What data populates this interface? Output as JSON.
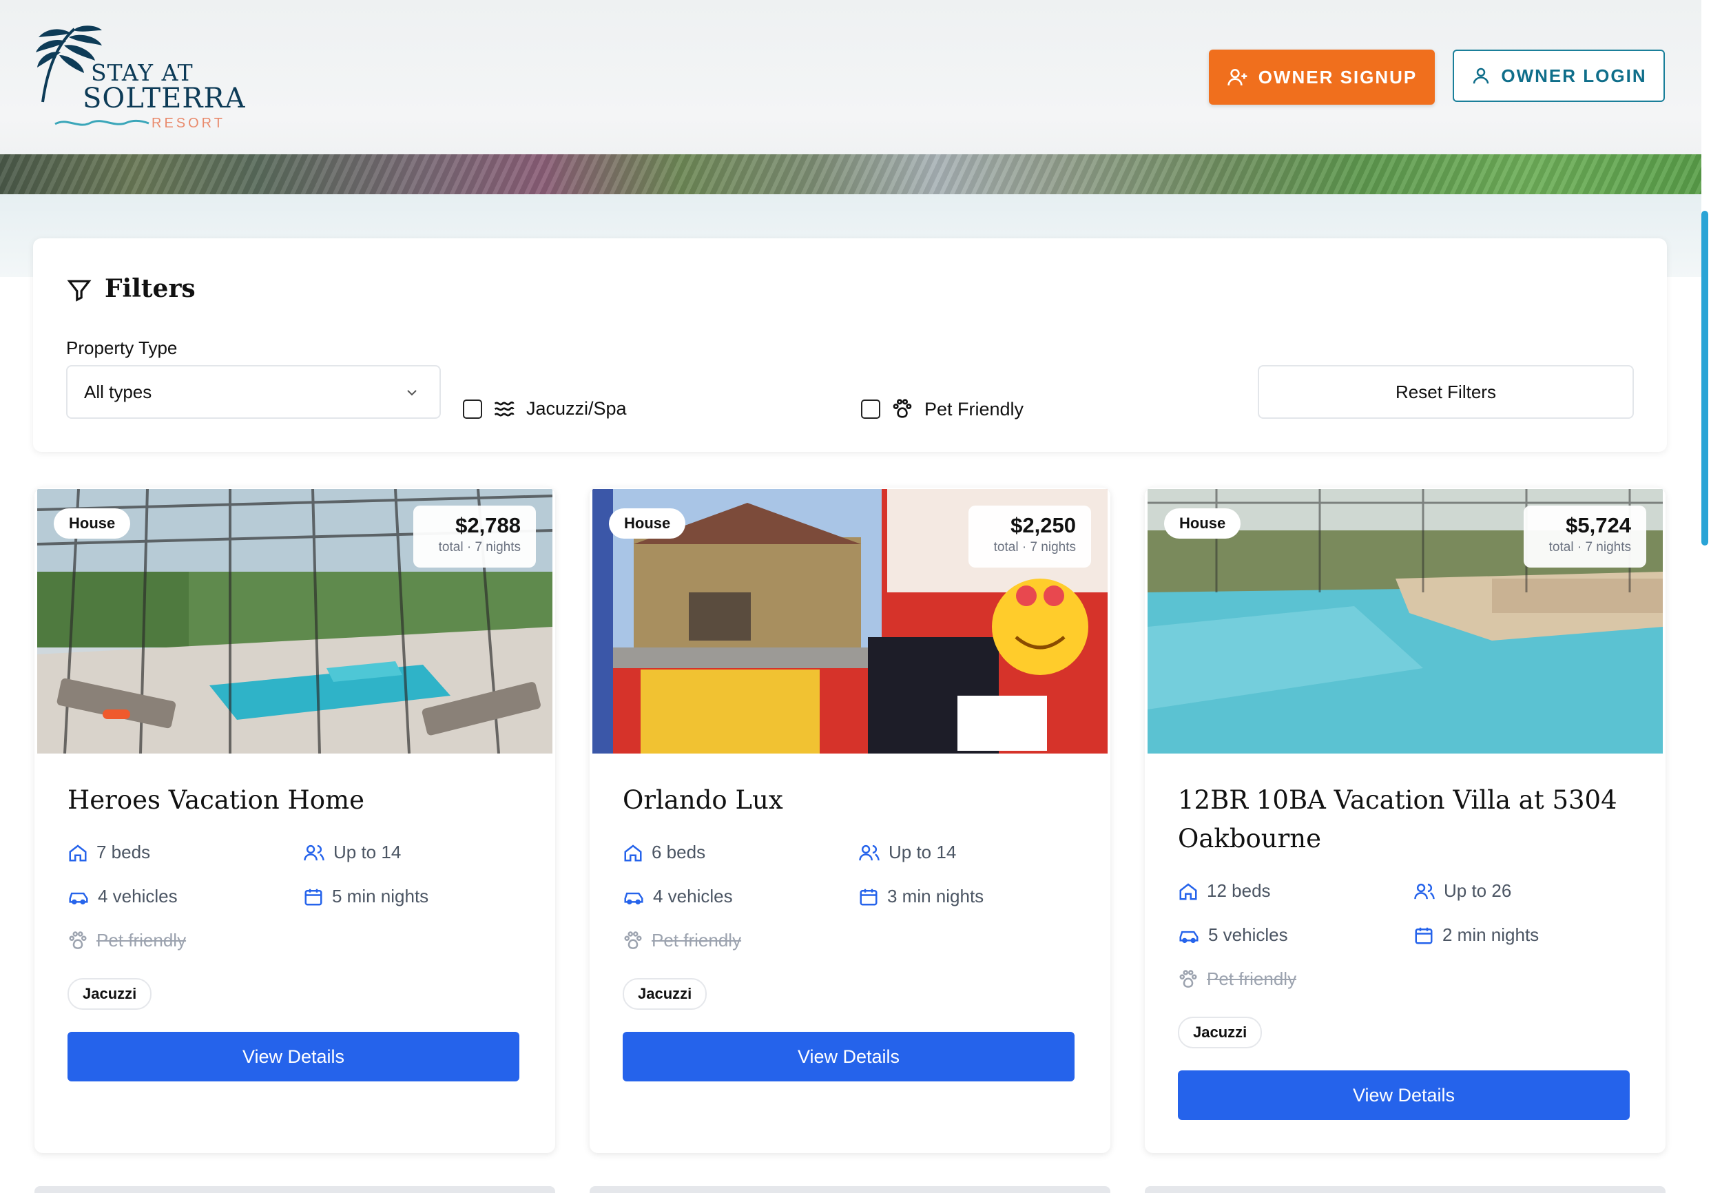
{
  "header": {
    "logo_line1": "STAY AT",
    "logo_line2": "SOLTERRA",
    "logo_line3": "RESORT",
    "signup_label": "OWNER SIGNUP",
    "login_label": "OWNER LOGIN",
    "accent_orange": "#f06f1d",
    "accent_teal": "#1a7f9a"
  },
  "filters": {
    "title": "Filters",
    "property_type_label": "Property Type",
    "property_type_value": "All types",
    "jacuzzi_label": "Jacuzzi/Spa",
    "pet_label": "Pet Friendly",
    "reset_label": "Reset Filters"
  },
  "listings": [
    {
      "type": "House",
      "price": "$2,788",
      "price_sub": "total · 7 nights",
      "title": "Heroes Vacation Home",
      "beds": "7 beds",
      "guests": "Up to 14",
      "vehicles": "4 vehicles",
      "min_nights": "5 min nights",
      "pet": "Pet friendly",
      "tag": "Jacuzzi",
      "cta": "View Details"
    },
    {
      "type": "House",
      "price": "$2,250",
      "price_sub": "total · 7 nights",
      "title": "Orlando Lux",
      "beds": "6 beds",
      "guests": "Up to 14",
      "vehicles": "4 vehicles",
      "min_nights": "3 min nights",
      "pet": "Pet friendly",
      "tag": "Jacuzzi",
      "cta": "View Details"
    },
    {
      "type": "House",
      "price": "$5,724",
      "price_sub": "total · 7 nights",
      "title": "12BR 10BA Vacation Villa at 5304 Oakbourne",
      "beds": "12 beds",
      "guests": "Up to 26",
      "vehicles": "5 vehicles",
      "min_nights": "2 min nights",
      "pet": "Pet friendly",
      "tag": "Jacuzzi",
      "cta": "View Details"
    }
  ],
  "colors": {
    "primary_button": "#2563eb"
  }
}
